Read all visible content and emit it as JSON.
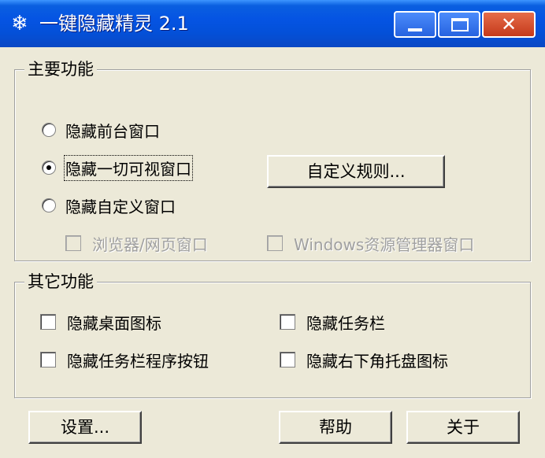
{
  "window": {
    "icon": "snowflake-icon",
    "title": "一键隐藏精灵 2.1",
    "controls": {
      "minimize": "minimize-icon",
      "maximize": "maximize-icon",
      "close": "close-icon"
    }
  },
  "main_group": {
    "title": "主要功能",
    "radios": [
      {
        "label": "隐藏前台窗口",
        "checked": false
      },
      {
        "label": "隐藏一切可视窗口",
        "checked": true
      },
      {
        "label": "隐藏自定义窗口",
        "checked": false
      }
    ],
    "custom_rules_button": "自定义规则...",
    "sub_checks": [
      {
        "label": "浏览器/网页窗口",
        "checked": false,
        "enabled": false
      },
      {
        "label": "Windows资源管理器窗口",
        "checked": false,
        "enabled": false
      }
    ]
  },
  "other_group": {
    "title": "其它功能",
    "checks": [
      {
        "label": "隐藏桌面图标",
        "checked": false
      },
      {
        "label": "隐藏任务栏",
        "checked": false
      },
      {
        "label": "隐藏任务栏程序按钮",
        "checked": false
      },
      {
        "label": "隐藏右下角托盘图标",
        "checked": false
      }
    ]
  },
  "buttons": {
    "settings": "设置...",
    "help": "帮助",
    "about": "关于"
  }
}
